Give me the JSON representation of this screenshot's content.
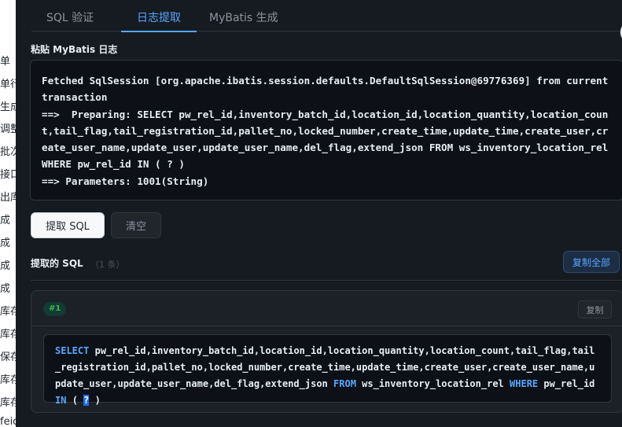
{
  "tabs": [
    {
      "label": "SQL 验证"
    },
    {
      "label": "日志提取",
      "active": true
    },
    {
      "label": "MyBatis 生成"
    }
  ],
  "theme_icon": "sun-icon",
  "log_section": {
    "label": "粘贴 MyBatis 日志",
    "content": "Fetched SqlSession [org.apache.ibatis.session.defaults.DefaultSqlSession@69776369] from current transaction\n==>  Preparing: SELECT pw_rel_id,inventory_batch_id,location_id,location_quantity,location_count,tail_flag,tail_registration_id,pallet_no,locked_number,create_time,update_time,create_user,create_user_name,update_user,update_user_name,del_flag,extend_json FROM ws_inventory_location_rel WHERE pw_rel_id IN ( ? )\n==> Parameters: 1001(String)"
  },
  "actions": {
    "extract_label": "提取 SQL",
    "clear_label": "清空"
  },
  "extracted": {
    "label": "提取的 SQL",
    "count": "（1 条）",
    "copy_all_label": "复制全部",
    "items": [
      {
        "badge": "#1",
        "copy_label": "复制",
        "sql_parts": {
          "kw_select": "SELECT",
          "columns": "pw_rel_id,inventory_batch_id,location_id,location_quantity,location_count,tail_flag,tail_registration_id,pallet_no,locked_number,create_time,update_time,create_user,create_user_name,update_user,update_user_name,del_flag,extend_json",
          "kw_from": "FROM",
          "table": "ws_inventory_location_rel",
          "kw_where": "WHERE",
          "column": "pw_rel_id",
          "kw_in": "IN",
          "open": "(",
          "placeholder": "?",
          "close": ")"
        }
      }
    ]
  },
  "left_fragments": [
    "单（",
    "单行",
    "生成",
    "调整",
    "批次",
    "接口",
    "出库",
    "成",
    "成",
    "成",
    "成",
    "库存",
    "库存",
    "保存",
    "库存",
    "库存",
    "feic"
  ]
}
